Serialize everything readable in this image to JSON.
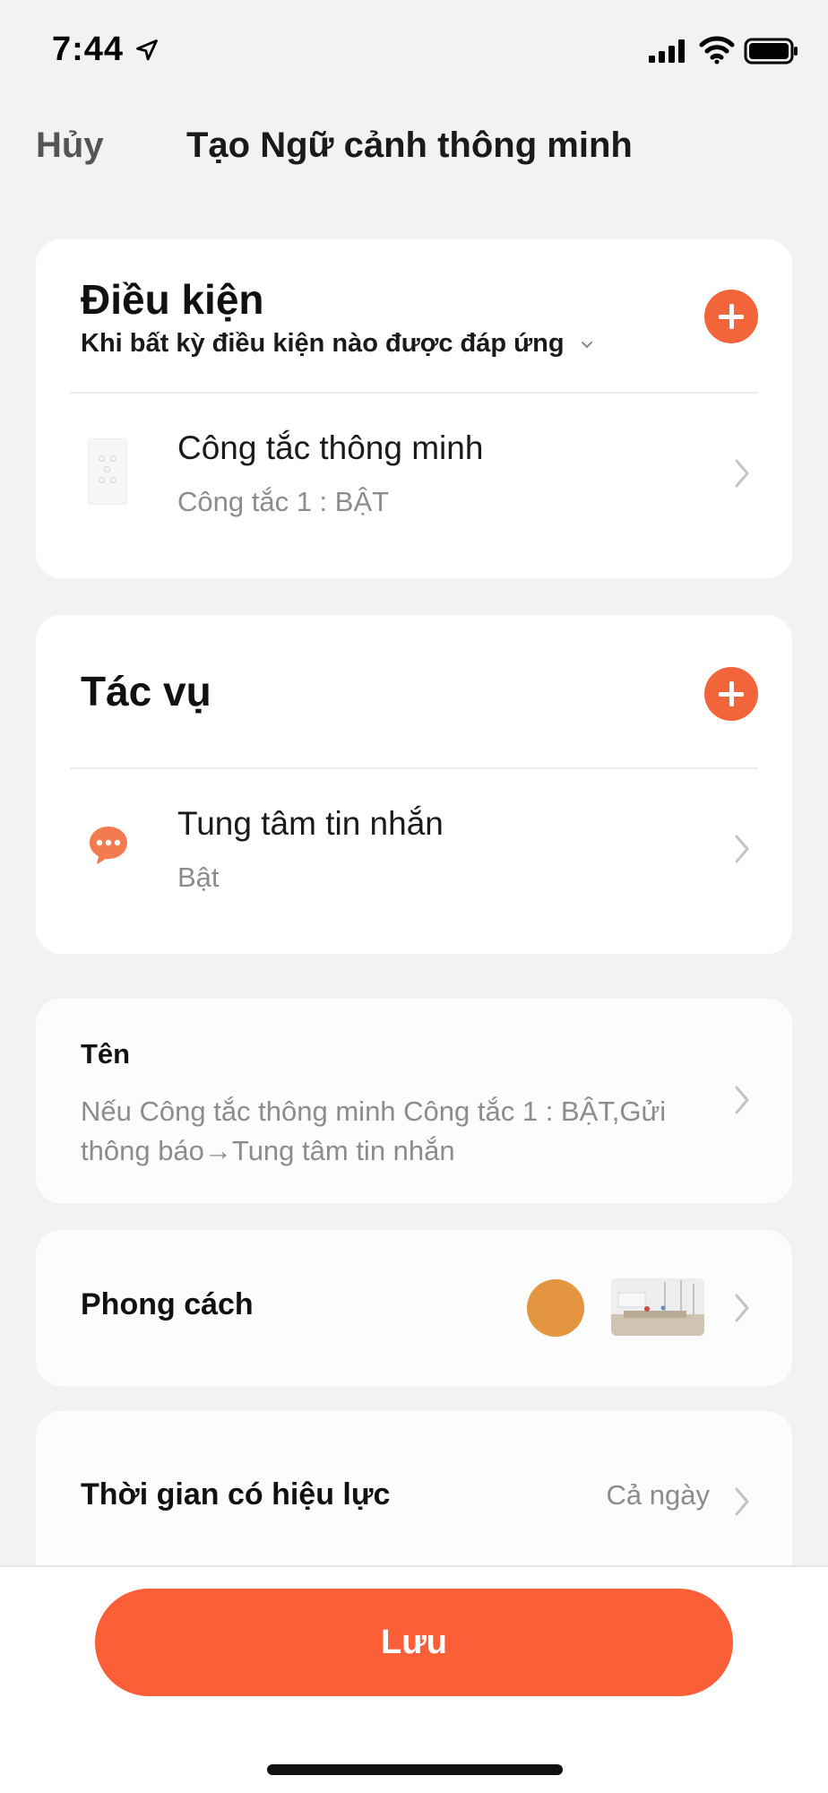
{
  "status_bar": {
    "time": "7:44",
    "icons": [
      "location-arrow-icon",
      "cellular-signal-icon",
      "wifi-icon",
      "battery-icon"
    ]
  },
  "nav": {
    "cancel_label": "Hủy",
    "title": "Tạo Ngữ cảnh thông minh"
  },
  "conditions": {
    "title": "Điều kiện",
    "subtitle": "Khi bất kỳ điều kiện nào được đáp ứng",
    "items": [
      {
        "icon": "wall-switch-icon",
        "title": "Công tắc thông minh",
        "subtitle": "Công tắc 1 : BẬT"
      }
    ]
  },
  "actions": {
    "title": "Tác vụ",
    "items": [
      {
        "icon": "message-bubble-icon",
        "title": "Tung tâm tin nhắn",
        "subtitle": "Bật"
      }
    ]
  },
  "name": {
    "label": "Tên",
    "value": "Nếu Công tắc thông minh Công tắc 1 : BẬT,Gửi thông báo→Tung tâm tin nhắn"
  },
  "style": {
    "label": "Phong cách",
    "color": "#e49540"
  },
  "validity": {
    "label": "Thời gian có hiệu lực",
    "value": "Cả ngày"
  },
  "footer": {
    "save_label": "Lưu"
  },
  "colors": {
    "accent": "#f2643a",
    "save_button": "#fb5f38",
    "background": "#f2f2f2"
  }
}
